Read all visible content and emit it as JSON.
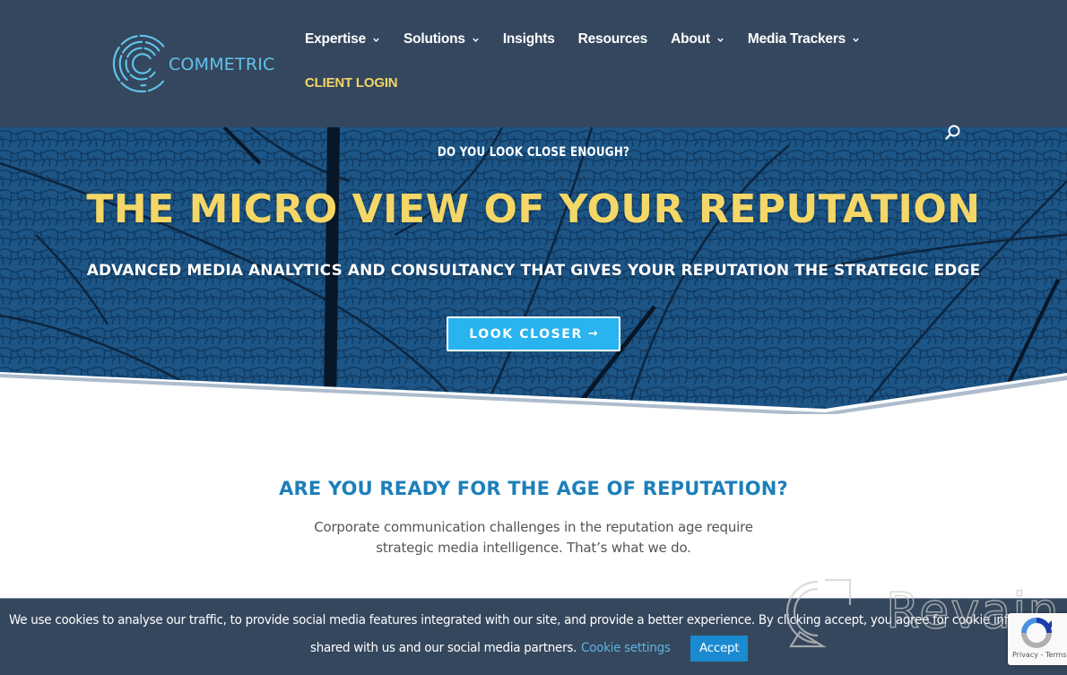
{
  "brand": {
    "logo_text": "COMMETRIC"
  },
  "nav": {
    "items": [
      {
        "label": "Expertise",
        "has_dropdown": true
      },
      {
        "label": "Solutions",
        "has_dropdown": true
      },
      {
        "label": "Insights",
        "has_dropdown": false
      },
      {
        "label": "Resources",
        "has_dropdown": false
      },
      {
        "label": "About",
        "has_dropdown": true
      },
      {
        "label": "Media Trackers",
        "has_dropdown": true
      }
    ],
    "client_login": "CLIENT LOGIN",
    "search_icon": "search-icon"
  },
  "hero": {
    "kicker": "DO YOU LOOK CLOSE ENOUGH?",
    "title": "THE MICRO VIEW OF YOUR REPUTATION",
    "subtitle": "ADVANCED MEDIA ANALYTICS AND CONSULTANCY THAT GIVES YOUR REPUTATION THE STRATEGIC EDGE",
    "cta_label": "LOOK CLOSER",
    "cta_arrow": "→"
  },
  "section": {
    "title": "ARE YOU READY FOR THE AGE OF REPUTATION?",
    "body_line1": "Corporate communication challenges in the reputation age require",
    "body_line2": "strategic media intelligence. That’s what we do."
  },
  "cookie_bar": {
    "text_line1": "We use cookies to analyse our traffic, to provide social media features integrated with our site, and provide a better experience. By clicking accept, you agree for cookie informat",
    "text_line2": "shared with us and our social media partners.",
    "settings_label": "Cookie settings",
    "accept_label": "Accept"
  },
  "watermark": {
    "text": "Revain"
  },
  "recaptcha": {
    "links": "Privacy - Terms"
  },
  "colors": {
    "header_bg": "#35475e",
    "logo": "#5fc4ea",
    "client_login": "#f2d664",
    "hero_title": "#f4d766",
    "cta_bg": "#29b4ef",
    "section_title": "#1d7fb9",
    "cookie_bg": "#34475d",
    "accept_bg": "#1a8ad1",
    "cookie_link": "#5fb2e0"
  }
}
